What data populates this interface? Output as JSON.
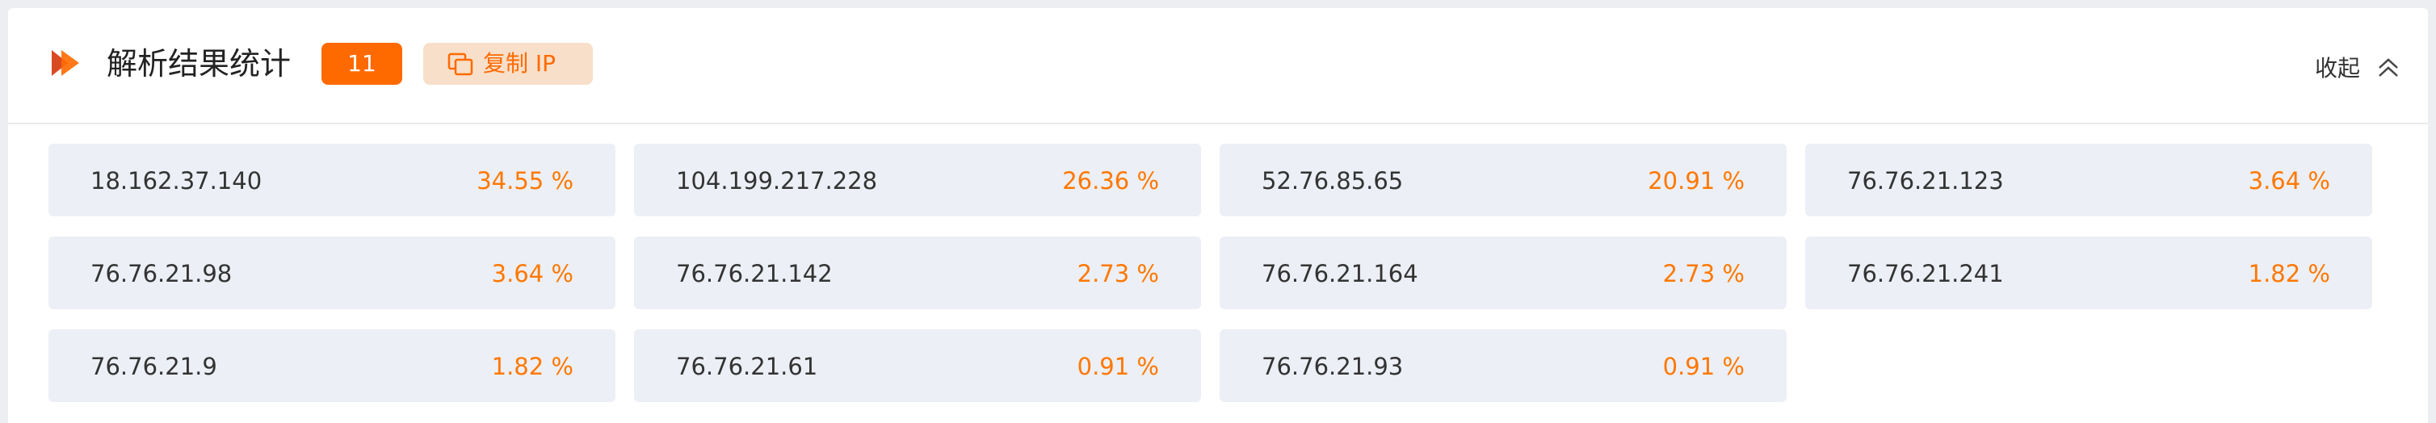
{
  "header": {
    "title": "解析结果统计",
    "count": "11",
    "copy_label": "复制 IP",
    "collapse_label": "收起"
  },
  "icons": {
    "logo": "double-chevron-right-icon",
    "copy": "copy-icon",
    "collapse": "chevron-up-double-icon"
  },
  "colors": {
    "accent": "#ff6a00",
    "percent": "#ff7800",
    "copy_button_bg": "#f8dfc9",
    "card_bg": "#eceff5"
  },
  "results": [
    {
      "ip": "18.162.37.140",
      "percent": "34.55 %"
    },
    {
      "ip": "104.199.217.228",
      "percent": "26.36 %"
    },
    {
      "ip": "52.76.85.65",
      "percent": "20.91 %"
    },
    {
      "ip": "76.76.21.123",
      "percent": "3.64 %"
    },
    {
      "ip": "76.76.21.98",
      "percent": "3.64 %"
    },
    {
      "ip": "76.76.21.142",
      "percent": "2.73 %"
    },
    {
      "ip": "76.76.21.164",
      "percent": "2.73 %"
    },
    {
      "ip": "76.76.21.241",
      "percent": "1.82 %"
    },
    {
      "ip": "76.76.21.9",
      "percent": "1.82 %"
    },
    {
      "ip": "76.76.21.61",
      "percent": "0.91 %"
    },
    {
      "ip": "76.76.21.93",
      "percent": "0.91 %"
    }
  ]
}
